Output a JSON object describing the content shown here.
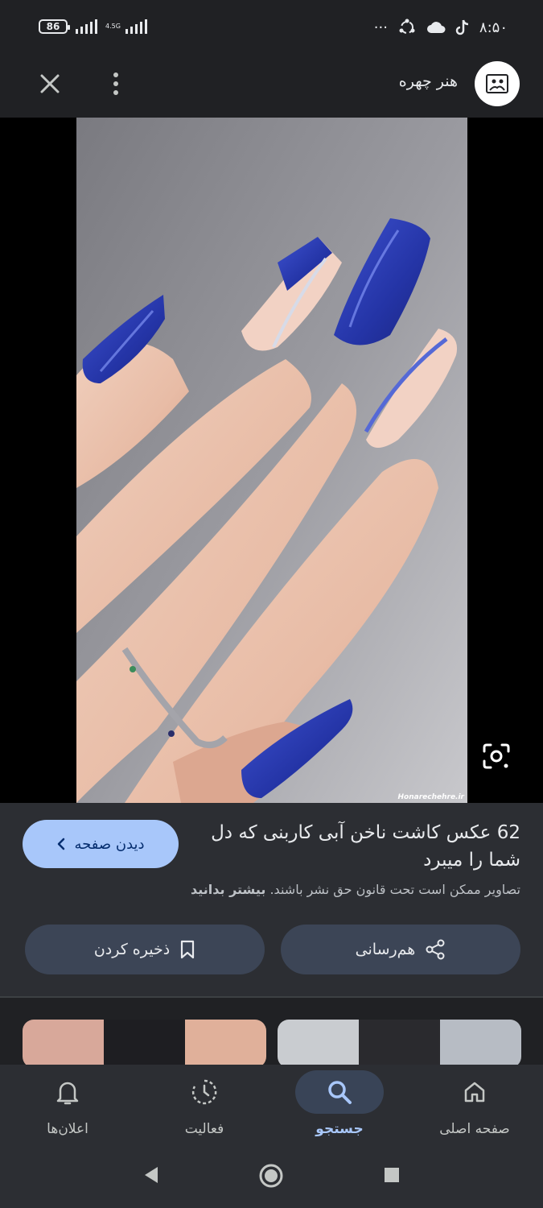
{
  "status_bar": {
    "battery": "86",
    "network": "4.5G",
    "dots": "···",
    "time": "۸:۵۰"
  },
  "header": {
    "source_name": "هنر چهره",
    "close_icon": "close-icon",
    "more_icon": "more-vert-icon"
  },
  "image": {
    "watermark": "Honarechehre.ir",
    "lens_icon": "lens-icon"
  },
  "result": {
    "title": "62 عکس کاشت ناخن آبی کاربنی که دل شما را میبرد",
    "visit_label": "دیدن صفحه",
    "copyright_text": "تصاویر ممکن است تحت قانون حق نشر باشند.",
    "learn_more": "بیشتر بدانید",
    "share_label": "هم‌رسانی",
    "save_label": "ذخیره کردن"
  },
  "bottom_nav": {
    "items": [
      {
        "label": "صفحه اصلی",
        "icon": "home-icon"
      },
      {
        "label": "جستجو",
        "icon": "search-icon",
        "active": true
      },
      {
        "label": "فعالیت",
        "icon": "activity-icon"
      },
      {
        "label": "اعلان‌ها",
        "icon": "bell-icon"
      }
    ]
  },
  "colors": {
    "background": "#202124",
    "panel": "#2c2e33",
    "accent": "#a8c7fa",
    "button": "#3c4556",
    "nail_blue": "#2a3aa8"
  }
}
